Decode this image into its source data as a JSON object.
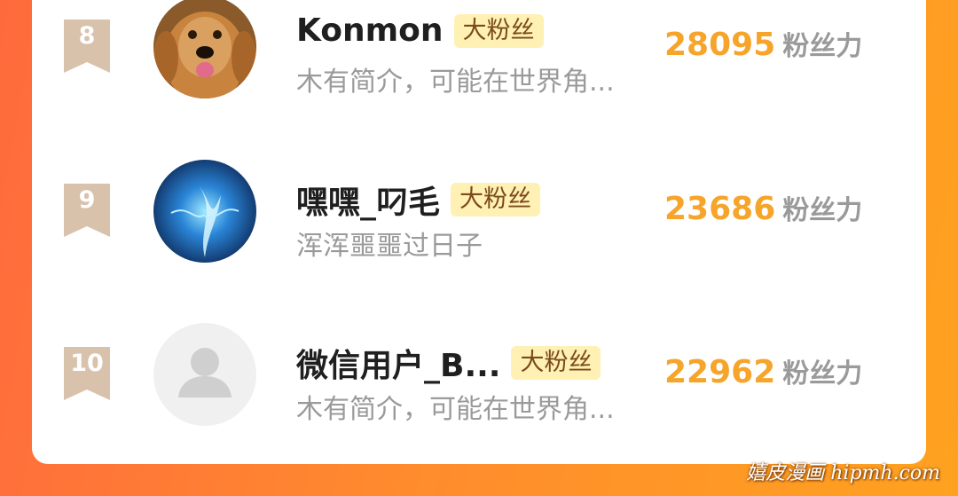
{
  "fans_list": {
    "rows": [
      {
        "rank": "8",
        "name": "Konmon",
        "badge": "大粉丝",
        "bio": "木有简介，可能在世界角...",
        "score": "28095",
        "score_label": "粉丝力",
        "avatar_icon": "dog-photo-avatar"
      },
      {
        "rank": "9",
        "name": "嘿嘿_叼毛",
        "badge": "大粉丝",
        "bio": "浑浑噩噩过日子",
        "score": "23686",
        "score_label": "粉丝力",
        "avatar_icon": "blue-energy-avatar"
      },
      {
        "rank": "10",
        "name": "微信用户_B...",
        "badge": "大粉丝",
        "bio": "木有简介，可能在世界角...",
        "score": "22962",
        "score_label": "粉丝力",
        "avatar_icon": "default-user-avatar"
      }
    ]
  },
  "watermark": "嬉皮漫画 hipmh.com",
  "colors": {
    "score": "#f6a42a",
    "badge_bg": "#fff0b4",
    "rank_ribbon": "#d8c2ac",
    "background_start": "#ff6a3d",
    "background_end": "#ffa21f"
  }
}
